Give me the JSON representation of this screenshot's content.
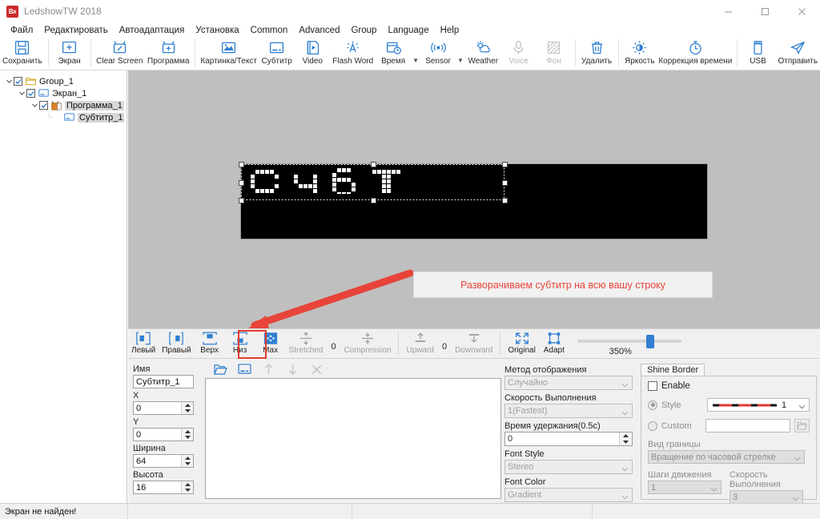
{
  "window": {
    "title": "LedshowTW 2018",
    "logo_text": "Bx",
    "minimize": "–",
    "maximize": "□",
    "close": "✕"
  },
  "menubar": {
    "items": [
      {
        "label": "Файл"
      },
      {
        "label": "Редактировать"
      },
      {
        "label": "Автоадаптация"
      },
      {
        "label": "Установка"
      },
      {
        "label": "Common"
      },
      {
        "label": "Advanced"
      },
      {
        "label": "Group"
      },
      {
        "label": "Language"
      },
      {
        "label": "Help"
      }
    ]
  },
  "ribbon": {
    "buttons": [
      {
        "label": "Сохранить",
        "icon": "save-icon",
        "disabled": false
      },
      {
        "label": "Экран",
        "icon": "screen-add-icon",
        "disabled": false
      },
      {
        "label": "Clear Screen",
        "icon": "clear-screen-icon",
        "disabled": false
      },
      {
        "label": "Программа",
        "icon": "program-add-icon",
        "disabled": false
      },
      {
        "label": "Картинка/Текст",
        "icon": "image-text-icon",
        "disabled": false
      },
      {
        "label": "Субтитр",
        "icon": "subtitle-icon",
        "disabled": false
      },
      {
        "label": "Video",
        "icon": "video-icon",
        "disabled": false
      },
      {
        "label": "Flash Word",
        "icon": "flash-word-icon",
        "disabled": false
      },
      {
        "label": "Время",
        "icon": "time-icon",
        "disabled": false
      },
      {
        "label": "Sensor",
        "icon": "sensor-icon",
        "disabled": false
      },
      {
        "label": "Weather",
        "icon": "weather-icon",
        "disabled": false
      },
      {
        "label": "Voice",
        "icon": "voice-icon",
        "disabled": true
      },
      {
        "label": "Фон",
        "icon": "background-icon",
        "disabled": true
      },
      {
        "label": "Удалить",
        "icon": "trash-icon",
        "disabled": false
      },
      {
        "label": "Яркость",
        "icon": "brightness-icon",
        "disabled": false
      },
      {
        "label": "Коррекция времени",
        "icon": "clock-correction-icon",
        "disabled": false
      },
      {
        "label": "USB",
        "icon": "usb-icon",
        "disabled": false
      },
      {
        "label": "Отправить",
        "icon": "send-icon",
        "disabled": false
      }
    ]
  },
  "tree": {
    "nodes": [
      {
        "label": "Group_1",
        "icon": "folder-icon",
        "checked": true,
        "expanded": true,
        "depth": 0,
        "selected": false
      },
      {
        "label": "Экран_1",
        "icon": "screen-icon",
        "checked": true,
        "expanded": true,
        "depth": 1,
        "selected": false
      },
      {
        "label": "Программа_1",
        "icon": "program-icon",
        "checked": true,
        "expanded": true,
        "depth": 2,
        "selected": true
      },
      {
        "label": "Субтитр_1",
        "icon": "subtitle-node-icon",
        "checked": false,
        "expanded": false,
        "depth": 3,
        "selected": true
      }
    ]
  },
  "canvas": {
    "led_text": "Субт",
    "annotation": "Разворачиваем субтитр на всю вашу строку",
    "annotation_color": "#e8443a"
  },
  "midbar": {
    "buttons": [
      {
        "label": "Левый",
        "icon": "align-left-icon",
        "dim": false
      },
      {
        "label": "Правый",
        "icon": "align-right-icon",
        "dim": false
      },
      {
        "label": "Верх",
        "icon": "align-top-icon",
        "dim": false
      },
      {
        "label": "Низ",
        "icon": "align-bottom-icon",
        "dim": false
      },
      {
        "label": "Max",
        "icon": "maximize-region-icon",
        "dim": false,
        "highlighted": true
      },
      {
        "label": "Stretched",
        "icon": "stretch-icon",
        "dim": true
      },
      {
        "label": "Compression",
        "icon": "compression-icon",
        "dim": true
      },
      {
        "label": "Upward",
        "icon": "upward-icon",
        "dim": true
      },
      {
        "label": "Downward",
        "icon": "downward-icon",
        "dim": true
      },
      {
        "label": "Original",
        "icon": "original-size-icon",
        "dim": false
      },
      {
        "label": "Adapt",
        "icon": "adapt-icon",
        "dim": false
      }
    ],
    "stretch_value": "0",
    "move_value": "0",
    "zoom_label": "350%",
    "zoom_percent": 350
  },
  "properties": {
    "name_label": "Имя",
    "name_value": "Субтитр_1",
    "x_label": "X",
    "x_value": "0",
    "y_label": "Y",
    "y_value": "0",
    "width_label": "Ширина",
    "width_value": "64",
    "height_label": "Высота",
    "height_value": "16"
  },
  "list_tools": [
    {
      "icon": "open-folder-icon"
    },
    {
      "icon": "new-subtitle-icon"
    },
    {
      "icon": "move-up-icon"
    },
    {
      "icon": "move-down-icon"
    },
    {
      "icon": "delete-x-icon"
    }
  ],
  "options": {
    "display_method_label": "Метод отображения",
    "display_method_value": "Случайно",
    "speed_label": "Скорость Выполнения",
    "speed_value": "1(Fastest)",
    "hold_time_label": "Время удержания(0.5c)",
    "hold_time_value": "0",
    "font_style_label": "Font Style",
    "font_style_value": "Stereo",
    "font_color_label": "Font Color",
    "font_color_value": "Gradient"
  },
  "shine_border": {
    "tab_label": "Shine Border",
    "enable_label": "Enable",
    "enable_checked": false,
    "style_label": "Style",
    "style_value": "1",
    "custom_label": "Custom",
    "custom_value": "",
    "border_type_label": "Вид границы",
    "border_type_value": "Вращение по часовой стрелке",
    "steps_label": "Шаги движения",
    "steps_value": "1",
    "speed_label": "Скорость Выполнения",
    "speed_value": "3"
  },
  "statusbar": {
    "message": "Экран не найден!"
  }
}
